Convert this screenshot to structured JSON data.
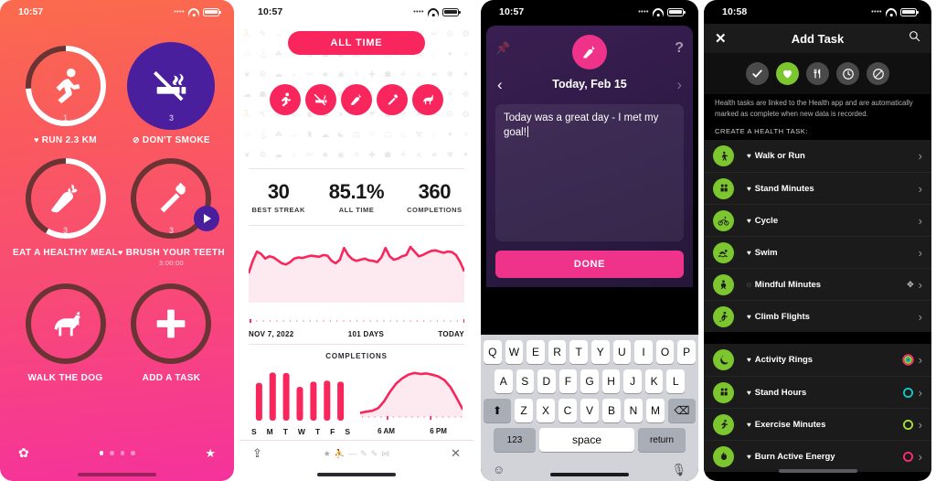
{
  "phone1": {
    "status": {
      "time": "10:57",
      "dots": "••••",
      "wifi": "wifi-icon",
      "battery": "battery-icon"
    },
    "tasks": [
      {
        "label": "RUN 2.3 KM",
        "glyph": "running-icon",
        "count": "1",
        "progress": 0.74,
        "style": "ring",
        "heart": true,
        "sub": ""
      },
      {
        "label": "DON'T SMOKE",
        "glyph": "no-smoking-icon",
        "count": "3",
        "progress": 1.0,
        "style": "solid",
        "heart": false,
        "mark": "no-entry-icon",
        "sub": ""
      },
      {
        "label": "EAT A HEALTHY MEAL",
        "glyph": "carrot-icon",
        "count": "3",
        "progress": 0.58,
        "style": "ring",
        "heart": false,
        "sub": ""
      },
      {
        "label": "BRUSH YOUR TEETH",
        "glyph": "toothbrush-icon",
        "count": "3",
        "progress": 0.0,
        "style": "ring",
        "heart": true,
        "sub": "3:00:00",
        "play": true
      },
      {
        "label": "WALK THE DOG",
        "glyph": "dog-icon",
        "count": "",
        "progress": 0.0,
        "style": "ring-empty",
        "heart": false,
        "sub": ""
      },
      {
        "label": "ADD A TASK",
        "glyph": "plus-icon",
        "count": "",
        "progress": 0.0,
        "style": "ring-empty",
        "heart": false,
        "sub": ""
      }
    ],
    "footer": {
      "settings_icon": "gear-icon",
      "star_icon": "star-icon",
      "page_dots": 4,
      "active_dot": 0
    }
  },
  "phone2": {
    "status": {
      "time": "10:57",
      "dots": "••••"
    },
    "range_button": "ALL TIME",
    "habit_icons": [
      "running-icon",
      "no-smoking-icon",
      "carrot-icon",
      "toothbrush-icon",
      "dog-icon"
    ],
    "stats": [
      {
        "value": "30",
        "label": "BEST STREAK"
      },
      {
        "value": "85.1%",
        "label": "ALL TIME"
      },
      {
        "value": "360",
        "label": "COMPLETIONS"
      }
    ],
    "trend_axis": {
      "left": "NOV 7, 2022",
      "center": "101 DAYS",
      "right": "TODAY"
    },
    "completions_title": "COMPLETIONS",
    "weekdays": [
      "S",
      "M",
      "T",
      "W",
      "T",
      "F",
      "S"
    ],
    "hours": [
      "6 AM",
      "6 PM"
    ],
    "bottom": {
      "share_icon": "share-icon",
      "close_icon": "close-icon",
      "star_icon": "star-icon"
    },
    "chart_data": [
      {
        "type": "area",
        "title": "Completion rate trend",
        "xlabel": "101 DAYS",
        "ylabel": "",
        "x": [
          "NOV 7, 2022",
          "TODAY"
        ],
        "ylim": [
          0,
          100
        ],
        "grid": false,
        "values": [
          41,
          62,
          78,
          74,
          66,
          70,
          68,
          63,
          58,
          56,
          60,
          66,
          68,
          67,
          69,
          71,
          70,
          69,
          72,
          71,
          62,
          58,
          64,
          84,
          72,
          65,
          62,
          64,
          66,
          63,
          62,
          60,
          68,
          84,
          70,
          64,
          66,
          70,
          72,
          86,
          78,
          70,
          72,
          76,
          79,
          80,
          78,
          76,
          78,
          77,
          72,
          60,
          44
        ]
      },
      {
        "type": "bar",
        "title": "COMPLETIONS",
        "categories": [
          "S",
          "M",
          "T",
          "W",
          "T",
          "F",
          "S"
        ],
        "values": [
          74,
          94,
          93,
          66,
          76,
          78,
          76
        ],
        "xlabel": "",
        "ylabel": "",
        "ylim": [
          0,
          100
        ],
        "grid": false
      },
      {
        "type": "area",
        "title": "Completions by hour",
        "x": [
          "6 AM",
          "6 PM"
        ],
        "xlabel": "",
        "ylabel": "",
        "ylim": [
          0,
          100
        ],
        "grid": false,
        "values": [
          5,
          8,
          10,
          16,
          32,
          54,
          72,
          84,
          92,
          96,
          94,
          95,
          92,
          88,
          80,
          64,
          40,
          14
        ]
      }
    ]
  },
  "phone3": {
    "status": {
      "time": "10:57",
      "dots": "••••"
    },
    "pin_icon": "pin-icon",
    "help_icon": "question-mark-icon",
    "avatar_icon": "carrot-icon",
    "prev_icon": "chevron-left-icon",
    "next_icon": "chevron-right-icon",
    "date_title": "Today, Feb 15",
    "note_text": "Today was a great day - I met my goal!",
    "done_button": "DONE",
    "keyboard": {
      "row1": [
        "Q",
        "W",
        "E",
        "R",
        "T",
        "Y",
        "U",
        "I",
        "O",
        "P"
      ],
      "row2": [
        "A",
        "S",
        "D",
        "F",
        "G",
        "H",
        "J",
        "K",
        "L"
      ],
      "row3": [
        "Z",
        "X",
        "C",
        "V",
        "B",
        "N",
        "M"
      ],
      "shift": "⬆",
      "backspace": "⌫",
      "numbers": "123",
      "space": "space",
      "return": "return",
      "emoji_icon": "emoji-icon",
      "mic_icon": "microphone-icon"
    }
  },
  "phone4": {
    "status": {
      "time": "10:58",
      "dots": "••••"
    },
    "nav": {
      "close_icon": "close-icon",
      "title": "Add Task",
      "search_icon": "search-icon"
    },
    "type_tabs": [
      {
        "icon": "check-icon",
        "name": "regular-task",
        "active": false
      },
      {
        "icon": "heart-icon",
        "name": "health-task",
        "active": true
      },
      {
        "icon": "fork-knife-icon",
        "name": "meal-task",
        "active": false
      },
      {
        "icon": "clock-icon",
        "name": "timed-task",
        "active": false
      },
      {
        "icon": "no-entry-icon",
        "name": "avoid-task",
        "active": false
      }
    ],
    "help_text": "Health tasks are linked to the Health app and are automatically marked as complete when new data is recorded.",
    "section_label": "CREATE A HEALTH TASK:",
    "group1": [
      {
        "label": "Walk or Run",
        "icon": "walking-icon",
        "mark": "heart-icon"
      },
      {
        "label": "Stand Minutes",
        "icon": "stand-icon",
        "mark": "heart-icon"
      },
      {
        "label": "Cycle",
        "icon": "cycling-icon",
        "mark": "heart-icon"
      },
      {
        "label": "Swim",
        "icon": "swimming-icon",
        "mark": "heart-icon"
      },
      {
        "label": "Mindful Minutes",
        "icon": "mindfulness-icon",
        "mark": "circle-icon",
        "badge": "settings-icon"
      },
      {
        "label": "Climb Flights",
        "icon": "stairs-icon",
        "mark": "heart-icon"
      }
    ],
    "group2": [
      {
        "label": "Activity Rings",
        "icon": "moon-icon",
        "mark": "heart-icon",
        "ring": "activity-rings-icon",
        "ring_color": "#ff2d6f"
      },
      {
        "label": "Stand Hours",
        "icon": "stand-icon",
        "mark": "heart-icon",
        "ring": "ring-icon",
        "ring_color": "#14c8c8"
      },
      {
        "label": "Exercise Minutes",
        "icon": "running-icon",
        "mark": "heart-icon",
        "ring": "ring-icon",
        "ring_color": "#a6e22e"
      },
      {
        "label": "Burn Active Energy",
        "icon": "flame-icon",
        "mark": "heart-icon",
        "ring": "ring-icon",
        "ring_color": "#ff2d6f"
      }
    ],
    "chevron_icon": "chevron-right-icon"
  },
  "colors": {
    "coral": "#fb6b4d",
    "pink": "#f5329b",
    "crimson": "#f8265c",
    "purple": "#4a1f9e",
    "note_purple": "#3a1f52",
    "hot_pink": "#f0338a",
    "green": "#7cc62f",
    "dark": "#1b1b1b"
  }
}
